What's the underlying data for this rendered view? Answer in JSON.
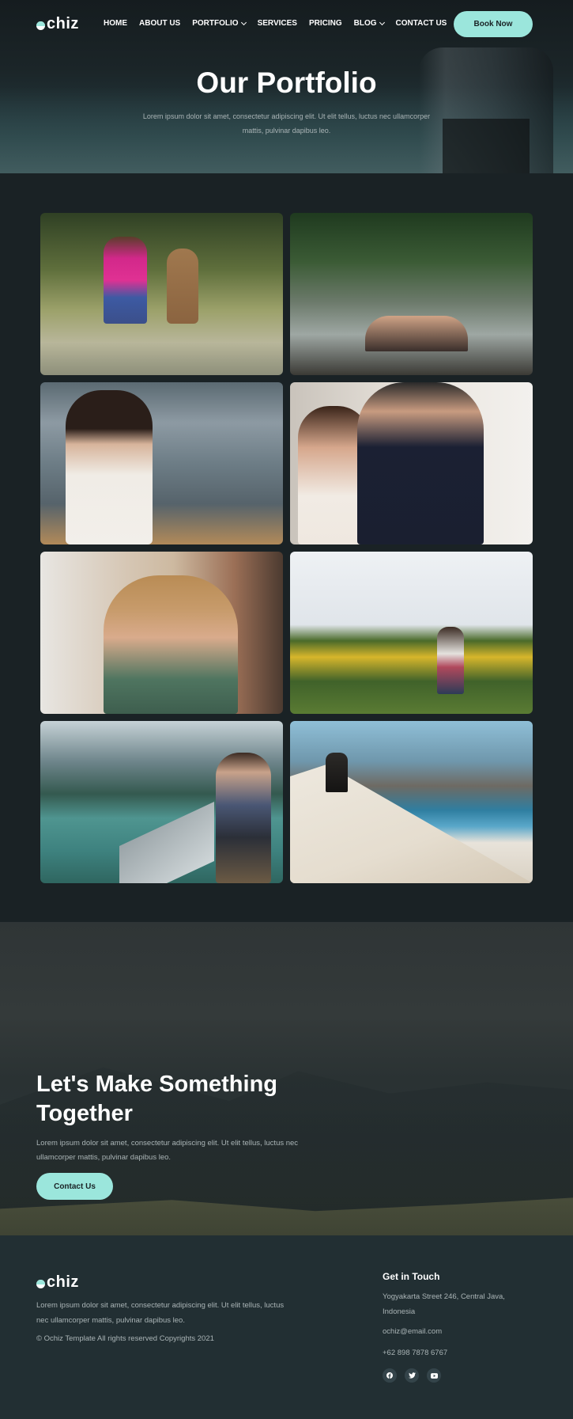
{
  "brand": {
    "name": "chiz",
    "accent": "#9be6dc"
  },
  "nav": {
    "items": [
      {
        "label": "HOME",
        "has_dropdown": false
      },
      {
        "label": "ABOUT US",
        "has_dropdown": false
      },
      {
        "label": "PORTFOLIO",
        "has_dropdown": true
      },
      {
        "label": "SERVICES",
        "has_dropdown": false
      },
      {
        "label": "PRICING",
        "has_dropdown": false
      },
      {
        "label": "BLOG",
        "has_dropdown": true
      },
      {
        "label": "CONTACT US",
        "has_dropdown": false
      }
    ],
    "cta_label": "Book Now"
  },
  "hero": {
    "title": "Our Portfolio",
    "subtitle": "Lorem ipsum dolor sit amet, consectetur adipiscing elit. Ut elit tellus, luctus nec ullamcorper mattis, pulvinar dapibus leo."
  },
  "portfolio": {
    "photos": [
      {
        "icon": "girl-with-rabbit-statue"
      },
      {
        "icon": "yoga-pose-rocks"
      },
      {
        "icon": "woman-on-beach"
      },
      {
        "icon": "wedding-ring-couple"
      },
      {
        "icon": "woman-with-camera"
      },
      {
        "icon": "couple-sunflower-field"
      },
      {
        "icon": "couple-by-lake"
      },
      {
        "icon": "hiker-on-snowy-coast"
      }
    ]
  },
  "cta": {
    "title": "Let's Make Something Together",
    "subtitle": "Lorem ipsum dolor sit amet, consectetur adipiscing elit. Ut elit tellus, luctus nec ullamcorper mattis, pulvinar dapibus leo.",
    "button_label": "Contact Us"
  },
  "footer": {
    "description": "Lorem ipsum dolor sit amet, consectetur adipiscing elit. Ut elit tellus, luctus nec ullamcorper mattis, pulvinar dapibus leo.",
    "copyright": "© Ochiz Template All rights reserved Copyrights 2021",
    "contact_heading": "Get in Touch",
    "address": "Yogyakarta Street 246, Central Java, Indonesia",
    "email": "ochiz@email.com",
    "phone": "+62 898 7878 6767",
    "socials": [
      "facebook-icon",
      "twitter-icon",
      "youtube-icon"
    ]
  }
}
